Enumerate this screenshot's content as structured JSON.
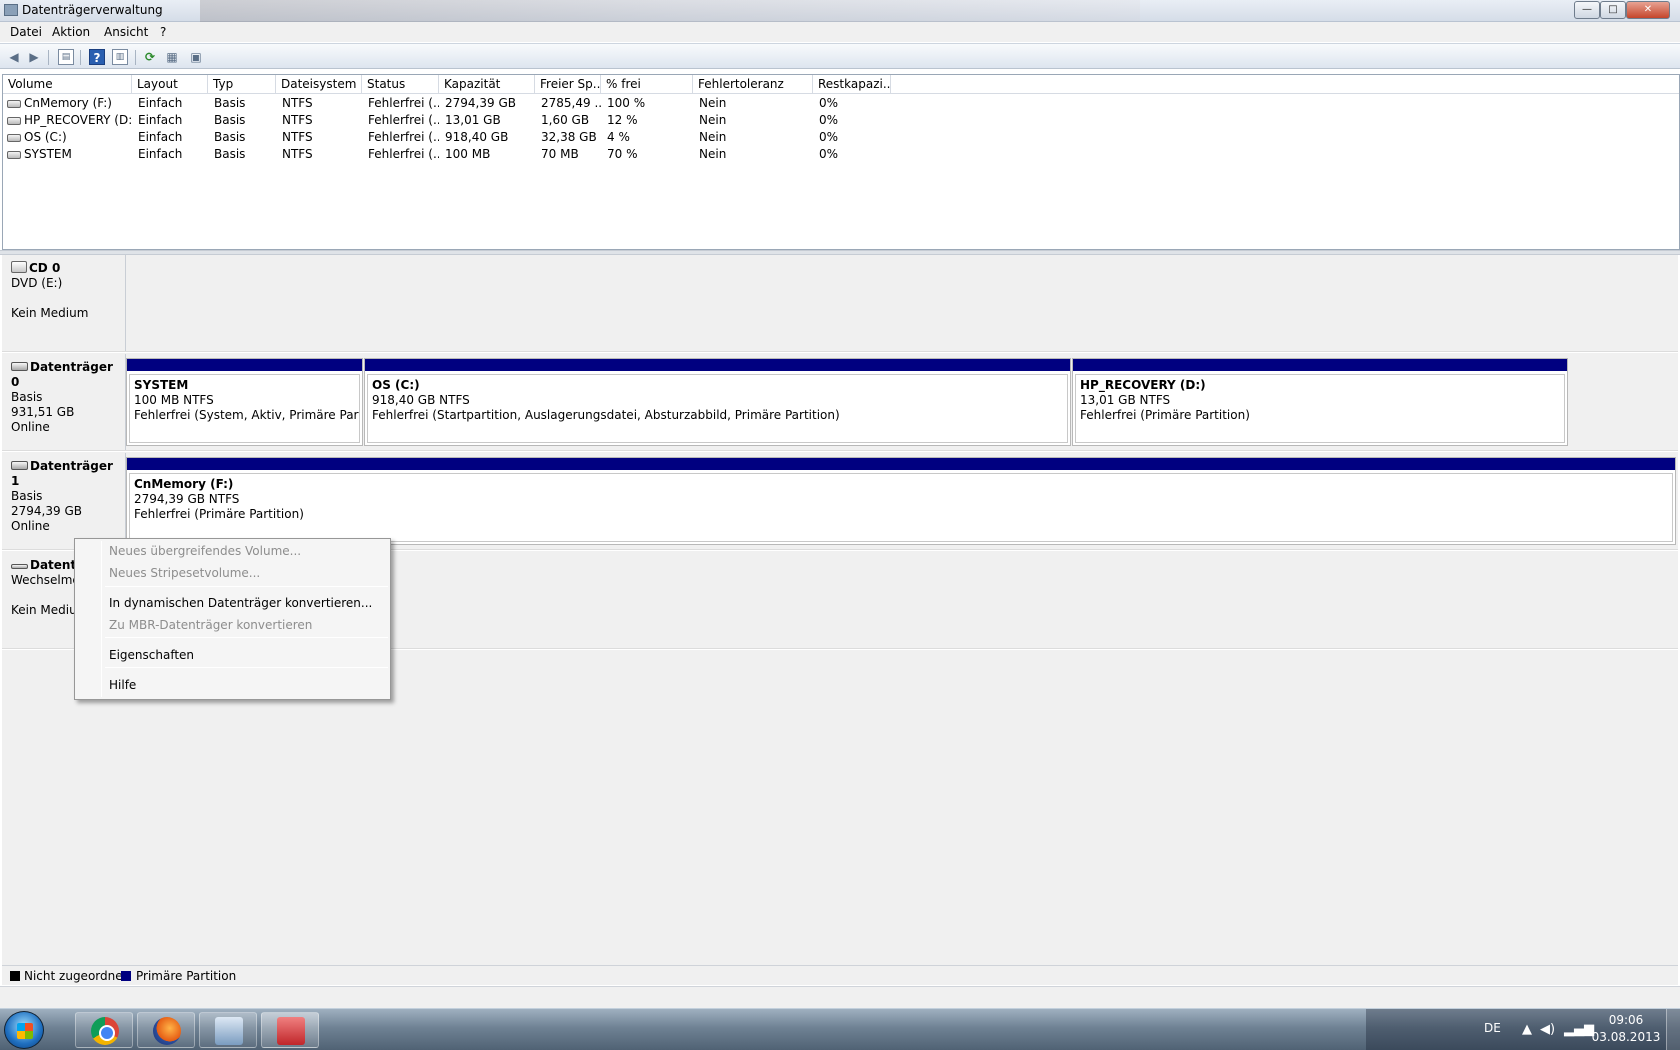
{
  "window": {
    "title": "Datenträgerverwaltung",
    "buttons": {
      "minimize": "—",
      "maximize": "□",
      "close": "✕"
    }
  },
  "menu": [
    "Datei",
    "Aktion",
    "Ansicht",
    "?"
  ],
  "toolbar": {
    "icons": [
      "back-arrow-icon",
      "forward-arrow-icon",
      "console-tree-icon",
      "help-icon",
      "show-hide-icon",
      "refresh-icon",
      "rescan-disks-icon",
      "properties-icon"
    ]
  },
  "volume_list": {
    "headers": [
      "Volume",
      "Layout",
      "Typ",
      "Dateisystem",
      "Status",
      "Kapazität",
      "Freier Sp...",
      "% frei",
      "Fehlertoleranz",
      "Restkapazi..."
    ],
    "rows": [
      [
        "CnMemory (F:)",
        "Einfach",
        "Basis",
        "NTFS",
        "Fehlerfrei (...",
        "2794,39 GB",
        "2785,49 ...",
        "100 %",
        "Nein",
        "0%"
      ],
      [
        "HP_RECOVERY (D:)",
        "Einfach",
        "Basis",
        "NTFS",
        "Fehlerfrei (...",
        "13,01 GB",
        "1,60 GB",
        "12 %",
        "Nein",
        "0%"
      ],
      [
        "OS (C:)",
        "Einfach",
        "Basis",
        "NTFS",
        "Fehlerfrei (...",
        "918,40 GB",
        "32,38 GB",
        "4 %",
        "Nein",
        "0%"
      ],
      [
        "SYSTEM",
        "Einfach",
        "Basis",
        "NTFS",
        "Fehlerfrei (...",
        "100 MB",
        "70 MB",
        "70 %",
        "Nein",
        "0%"
      ]
    ]
  },
  "disks": {
    "cd0": {
      "name": "CD 0",
      "line1": "DVD (E:)",
      "line3": "Kein Medium"
    },
    "disk0": {
      "name": "Datenträger 0",
      "type": "Basis",
      "size": "931,51 GB",
      "state": "Online",
      "partitions": [
        {
          "title": "SYSTEM",
          "size": "100 MB NTFS",
          "status": "Fehlerfrei (System, Aktiv, Primäre Partition"
        },
        {
          "title": "OS  (C:)",
          "size": "918,40 GB NTFS",
          "status": "Fehlerfrei (Startpartition, Auslagerungsdatei, Absturzabbild, Primäre Partition)"
        },
        {
          "title": "HP_RECOVERY  (D:)",
          "size": "13,01 GB NTFS",
          "status": "Fehlerfrei (Primäre Partition)"
        }
      ]
    },
    "disk1": {
      "name": "Datenträger 1",
      "type": "Basis",
      "size": "2794,39 GB",
      "state": "Online",
      "partitions": [
        {
          "title": "CnMemory  (F:)",
          "size": "2794,39 GB NTFS",
          "status": "Fehlerfrei (Primäre Partition)"
        }
      ]
    },
    "disk2": {
      "name": "Datenträ",
      "type": "Wechselme",
      "state": "Kein Mediu"
    }
  },
  "context_menu": {
    "items": [
      {
        "label": "Neues übergreifendes Volume...",
        "enabled": false
      },
      {
        "label": "Neues Stripesetvolume...",
        "enabled": false
      },
      {
        "label": "In dynamischen Datenträger konvertieren...",
        "enabled": true
      },
      {
        "label": "Zu MBR-Datenträger konvertieren",
        "enabled": false
      },
      {
        "label": "Eigenschaften",
        "enabled": true
      },
      {
        "label": "Hilfe",
        "enabled": true
      }
    ]
  },
  "legend": {
    "unallocated": {
      "label": "Nicht zugeordnet",
      "color": "#000000"
    },
    "primary": {
      "label": "Primäre Partition",
      "color": "#000080"
    }
  },
  "taskbar": {
    "apps": [
      "chrome-icon",
      "firefox-icon",
      "network-icon",
      "toolbox-icon"
    ],
    "tray": {
      "language": "DE",
      "time": "09:06",
      "date": "03.08.2013"
    }
  },
  "colors": {
    "partition_bar": "#000080",
    "close_button": "#c5452b"
  }
}
